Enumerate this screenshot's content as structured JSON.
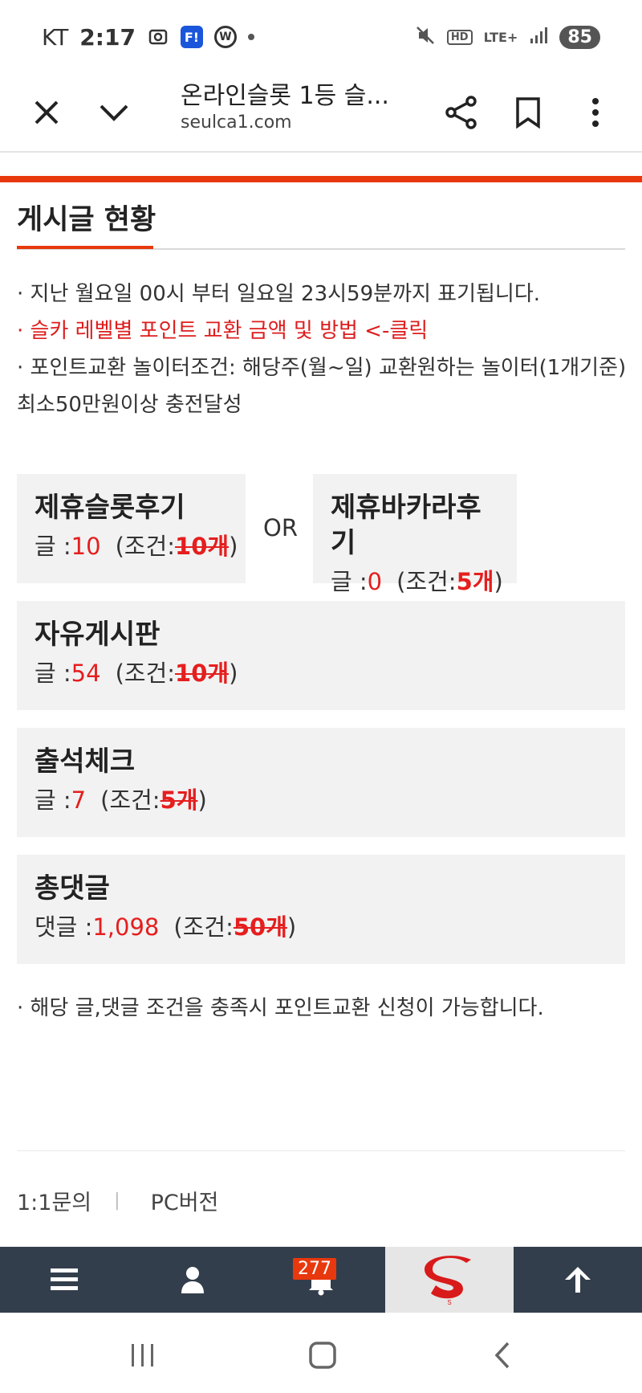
{
  "status_bar": {
    "carrier": "KT",
    "time": "2:17",
    "f_badge": "F!",
    "w_badge": "W",
    "hd": "HD",
    "network": "LTE+",
    "battery": "85"
  },
  "browser": {
    "title": "온라인슬롯 1등 슬...",
    "url": "seulca1.com"
  },
  "page": {
    "section_title": "게시글 현황",
    "notes": [
      "· 지난 월요일 00시 부터 일요일 23시59분까지 표기됩니다.",
      "· 슬카 레벨별 포인트 교환 금액 및 방법 <-클릭",
      "· 포인트교환 놀이터조건: 해당주(월~일) 교환원하는 놀이터(1개기준) 최소50만원이상 충전달성"
    ],
    "or_label": "OR",
    "boxes": {
      "slot": {
        "title": "제휴슬롯후기",
        "count_label": "글 :",
        "count": "10",
        "cond_open": "(조건:",
        "cond_value": "10개",
        "cond_close": ")"
      },
      "baccarat": {
        "title": "제휴바카라후기",
        "count_label": "글 :",
        "count": "0",
        "cond_open": "(조건:",
        "cond_value": "5개",
        "cond_close": ")"
      },
      "free": {
        "title": "자유게시판",
        "count_label": "글 :",
        "count": "54",
        "cond_open": "(조건:",
        "cond_value": "10개",
        "cond_close": ")"
      },
      "attendance": {
        "title": "출석체크",
        "count_label": "글 :",
        "count": "7",
        "cond_open": "(조건:",
        "cond_value": "5개",
        "cond_close": ")"
      },
      "comments": {
        "title": "총댓글",
        "count_label": "댓글 :",
        "count": "1,098",
        "cond_open": "(조건:",
        "cond_value": "50개",
        "cond_close": ")"
      }
    },
    "footnote": "· 해당 글,댓글 조건을 충족시 포인트교환 신청이 가능합니다.",
    "footer_links": [
      "1:1문의",
      "PC버전"
    ],
    "footer_sep": "|"
  },
  "site_nav": {
    "items": [
      "menu-icon",
      "user-icon",
      "bell-icon",
      "logo",
      "arrow-up-icon"
    ],
    "notification_count": "277",
    "logo_letter": "S"
  },
  "colors": {
    "accent": "#e8380d",
    "red_text": "#e51e1e",
    "box_bg": "#f2f2f2",
    "nav_bg": "#333e4c"
  }
}
